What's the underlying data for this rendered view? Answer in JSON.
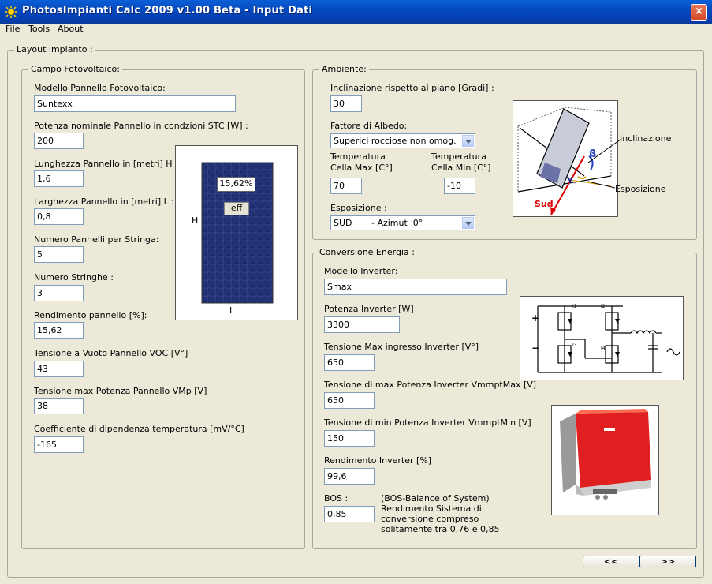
{
  "window": {
    "title": "PhotosImpianti Calc 2009 v1.00 Beta - Input Dati",
    "close_label": "×"
  },
  "menu": [
    "File",
    "Tools",
    "About"
  ],
  "layout_group": "Layout impianto :",
  "campo": {
    "legend": "Campo Fotovoltaico:",
    "fields": [
      {
        "label": "Modello Pannello Fotovoltaico:",
        "value": "Suntexx"
      },
      {
        "label": "Potenza nominale Pannello in condzioni STC [W] :",
        "value": "200"
      },
      {
        "label": "Lunghezza Pannello in [metri] H :",
        "value": "1,6"
      },
      {
        "label": "Larghezza Pannello in [metri] L :",
        "value": "0,8"
      },
      {
        "label": "Numero Pannelli per Stringa:",
        "value": "5"
      },
      {
        "label": "Numero Stringhe :",
        "value": "3"
      },
      {
        "label": "Rendimento pannello [%]:",
        "value": "15,62"
      },
      {
        "label": "Tensione a Vuoto Pannello VOC [V°]",
        "value": "43"
      },
      {
        "label": "Tensione max Potenza Pannello VMp [V]",
        "value": "38"
      },
      {
        "label": "Coefficiente di dipendenza temperatura  [mV/°C]",
        "value": "-165"
      }
    ],
    "panel_image": {
      "eff_value": "15,62%",
      "eff_button": "eff",
      "h_label": "H",
      "l_label": "L"
    }
  },
  "ambiente": {
    "legend": "Ambiente:",
    "inclinazione_label": "Inclinazione rispetto al piano [Gradi] :",
    "inclinazione_value": "30",
    "albedo_label": "Fattore di Albedo:",
    "albedo_value": "Superici rocciose non omog.",
    "temp_max_label_1": "Temperatura",
    "temp_max_label_2": "Cella Max [C°]",
    "temp_max_value": "70",
    "temp_min_label_1": "Temperatura",
    "temp_min_label_2": "Cella Min [C°]",
    "temp_min_value": "-10",
    "esposizione_label": "Esposizione :",
    "esposizione_value": "SUD       - Azimut  0°",
    "diagram": {
      "inclinazione": "Inclinazione",
      "esposizione": "Esposizione",
      "sud": "Sud",
      "beta": "β",
      "gamma": "γ"
    }
  },
  "conversione": {
    "legend": "Conversione Energia :",
    "fields": [
      {
        "label": "Modello Inverter:",
        "value": "Smax"
      },
      {
        "label": "Potenza Inverter [W]",
        "value": "3300"
      },
      {
        "label": "Tensione Max ingresso Inverter [V°]",
        "value": "650"
      },
      {
        "label": "Tensione di max Potenza Inverter VmmptMax [V]",
        "value": "650"
      },
      {
        "label": "Tensione di min Potenza Inverter VmmptMin [V]",
        "value": "150"
      },
      {
        "label": "Rendimento Inverter [%]",
        "value": "99,6"
      }
    ],
    "bos_label": "BOS :",
    "bos_value": "0,85",
    "bos_note": [
      "(BOS-Balance of System)",
      "Rendimento Sistema di",
      "conversione compreso",
      "solitamente tra 0,76 e 0,85"
    ],
    "circuit_labels": {
      "plus": "+",
      "minus": "−",
      "t1": "I1",
      "t2": "I2",
      "t3": "I3",
      "t4": "I4"
    }
  },
  "nav": {
    "prev": "<<",
    "next": ">>"
  },
  "colors": {
    "titlebar": "#0549c0",
    "background": "#ece9d8",
    "inverter_red": "#e02020"
  }
}
